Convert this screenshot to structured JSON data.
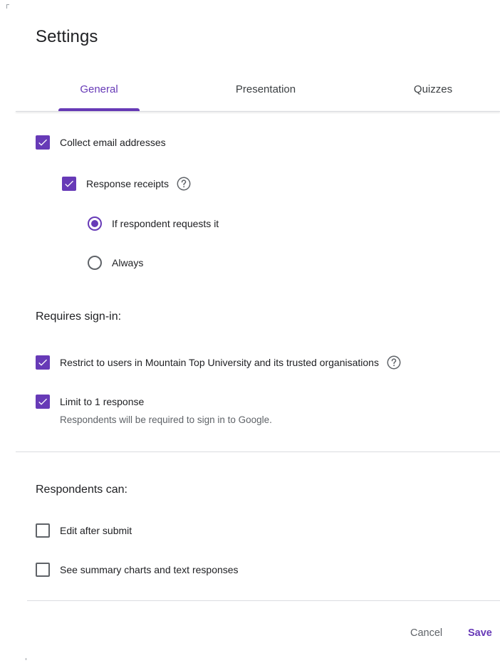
{
  "dialog": {
    "title": "Settings"
  },
  "tabs": [
    {
      "label": "General",
      "active": true
    },
    {
      "label": "Presentation",
      "active": false
    },
    {
      "label": "Quizzes",
      "active": false
    }
  ],
  "general": {
    "collect_email": {
      "label": "Collect email addresses",
      "checked": true
    },
    "response_receipts": {
      "label": "Response receipts",
      "checked": true
    },
    "receipt_options": [
      {
        "label": "If respondent requests it",
        "selected": true
      },
      {
        "label": "Always",
        "selected": false
      }
    ],
    "requires_signin": {
      "heading": "Requires sign-in:",
      "restrict": {
        "label": "Restrict to users in Mountain Top University and its trusted organisations",
        "checked": true
      },
      "limit": {
        "label": "Limit to 1 response",
        "checked": true,
        "subtext": "Respondents will be required to sign in to Google."
      }
    },
    "respondents_can": {
      "heading": "Respondents can:",
      "edit_after_submit": {
        "label": "Edit after submit",
        "checked": false
      },
      "see_summary": {
        "label": "See summary charts and text responses",
        "checked": false
      }
    }
  },
  "footer": {
    "cancel_label": "Cancel",
    "save_label": "Save"
  },
  "colors": {
    "accent": "#673ab7",
    "text": "#202124",
    "secondary_text": "#5f6368",
    "divider": "#dadce0"
  },
  "icons": {
    "checkbox_checked": "check-icon",
    "help": "help-circle-icon"
  }
}
